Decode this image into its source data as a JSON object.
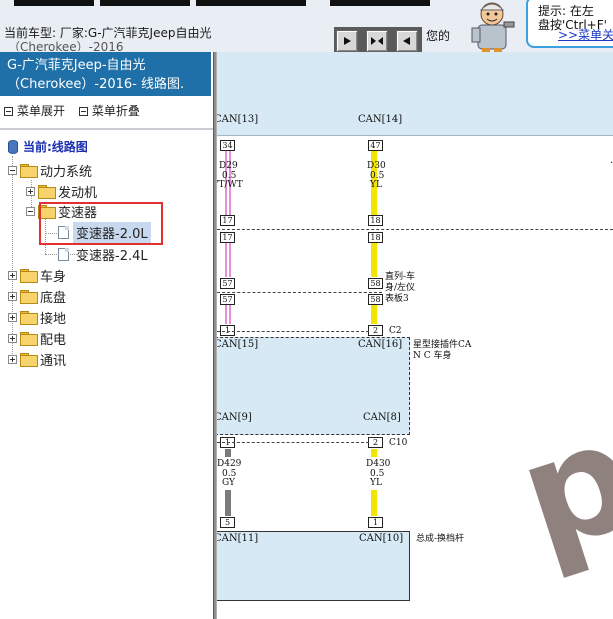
{
  "toolbar": {
    "car_label": "当前车型:  厂家:G-广汽菲克Jeep自由光",
    "car_label_line2": "（Cherokee）-2016",
    "your_text": "您的",
    "tip_line1": "提示: 在左",
    "tip_line2": "盘按'Ctrl+F'",
    "tip_link": ">>菜单关",
    "nav_icons": [
      "play-right-icon",
      "double-arrow-icon",
      "play-left-icon"
    ]
  },
  "sidebar": {
    "title_line1": "G-广汽菲克Jeep-自由光",
    "title_line2": "（Cherokee）-2016- 线路图.",
    "menu_expand": "菜单展开",
    "menu_collapse": "菜单折叠",
    "current": "当前:线路图",
    "tree": {
      "power": "动力系统",
      "engine": "发动机",
      "transmission": "变速器",
      "trans_20": "变速器-2.0L",
      "trans_24": "变速器-2.4L",
      "body": "车身",
      "chassis": "底盘",
      "ground": "接地",
      "power_dist": "配电",
      "comm": "通讯"
    }
  },
  "diagram": {
    "can13": "CAN[13]",
    "can14": "CAN[14]",
    "pin34": "34",
    "pin47": "47",
    "d29": "D29",
    "d29_size": "0.5",
    "d29_color": "VT/WT",
    "d30": "D30",
    "d30_size": "0.5",
    "d30_color": "YL",
    "pin17a": "17",
    "pin18a": "18",
    "pin17b": "17",
    "pin18b": "18",
    "note1_l1": "直列-车",
    "note1_l2": "身/左仪",
    "note1_l3": "表板3",
    "pin57a": "57",
    "pin58a": "58",
    "pin57b": "57",
    "pin58b": "58",
    "pin1a": "1",
    "pin2a": "2",
    "c2": "C2",
    "can15": "CAN[15]",
    "can16": "CAN[16]",
    "star_l1": "星型接插件CA",
    "star_l2": "N C 车身",
    "can9": "CAN[9]",
    "can8": "CAN[8]",
    "pin1b": "1",
    "pin2b": "2",
    "c10": "C10",
    "d429": "D429",
    "d429_size": "0.5",
    "d429_color": "GY",
    "d430": "D430",
    "d430_size": "0.5",
    "d430_color": "YL",
    "pin5": "5",
    "pin1c": "1",
    "can11": "CAN[11]",
    "can10": "CAN[10]",
    "shifter": "总成-换档杆",
    "watermark": "p",
    "wire_colors": {
      "pink": "#e58fd8",
      "yellow": "#f2e600",
      "gray": "#7a7a7a"
    }
  }
}
